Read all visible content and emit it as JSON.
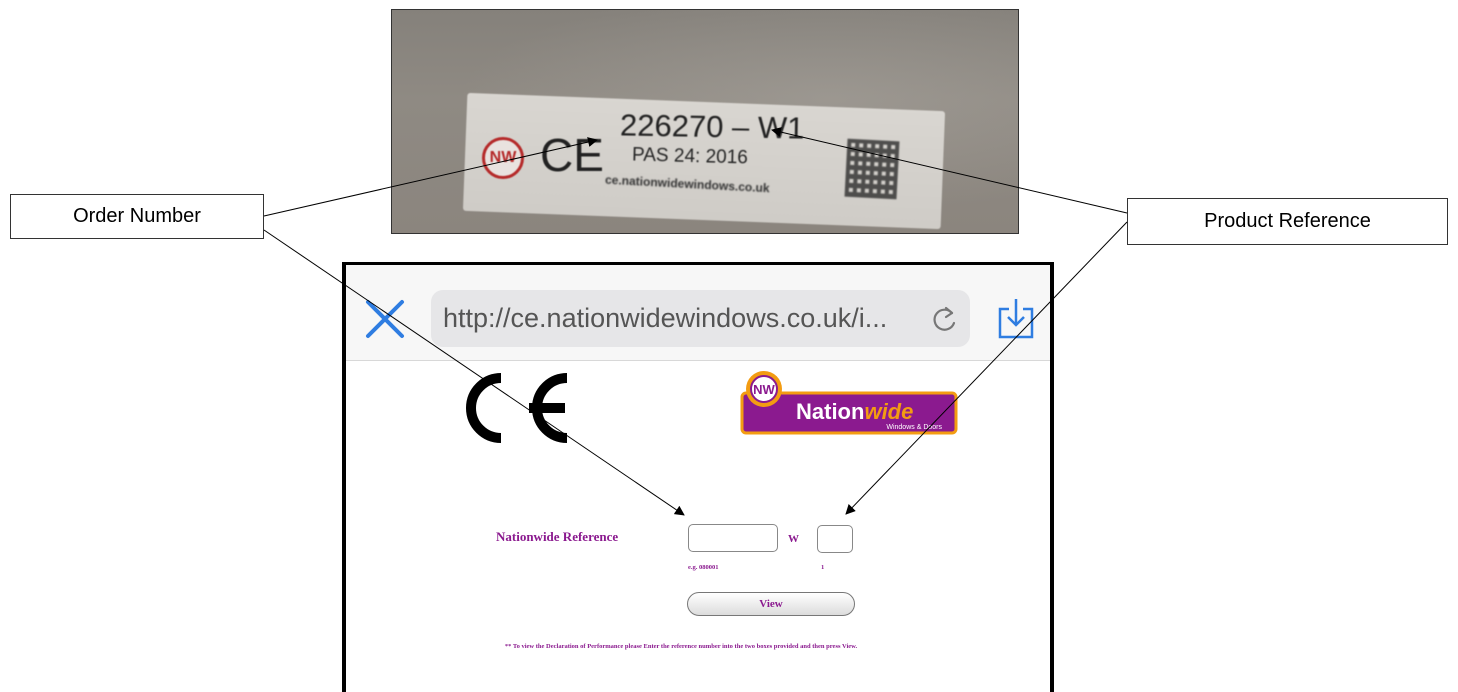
{
  "label_photo": {
    "logo_text": "NW",
    "ce_mark": "CE",
    "order_code": "226270 – W1",
    "standard": "PAS 24: 2016",
    "website": "ce.nationwidewindows.co.uk"
  },
  "callouts": {
    "order_number": "Order Number",
    "product_reference": "Product Reference"
  },
  "browser": {
    "url": "http://ce.nationwidewindows.co.uk/i..."
  },
  "page": {
    "ce_mark": "CE",
    "brand": {
      "badge": "NW",
      "name_plain": "Nation",
      "name_italic": "wide",
      "tagline": "Windows & Doors"
    },
    "form": {
      "label": "Nationwide Reference",
      "order_value": "",
      "separator": "W",
      "product_value": "",
      "order_hint": "e.g. 080001",
      "product_hint": "1",
      "view_button": "View"
    },
    "instructions": "** To view the Declaration of Performance please Enter the reference number into the two boxes provided and then press View."
  },
  "colors": {
    "brand_purple": "#8b1a8f",
    "brand_orange": "#f39c12",
    "ios_blue": "#2f7de1"
  }
}
